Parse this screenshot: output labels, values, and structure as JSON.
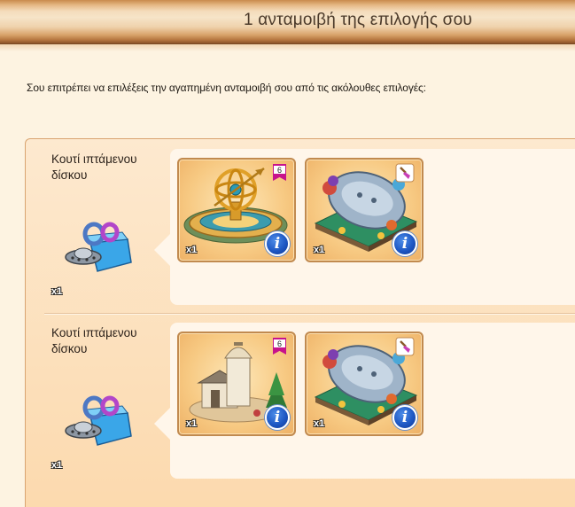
{
  "header": {
    "title": "1 ανταμοιβή της επιλογής σου"
  },
  "intro_text": "Σου επιτρέπει να επιλέξεις την αγαπημένη ανταμοιβή σου από τις ακόλουθες επιλογές:",
  "options": [
    {
      "source": {
        "name": "Κουτί ιπτάμενου δίσκου",
        "qty": "x1",
        "icon": "flying-saucer-box-icon"
      },
      "rewards": [
        {
          "icon": "armillary-sphere-decoration",
          "qty": "x1",
          "level_badge": "6"
        },
        {
          "icon": "ufo-crash-decoration",
          "qty": "x1",
          "badge_icon": "paintbrush-icon"
        }
      ]
    },
    {
      "source": {
        "name": "Κουτί ιπτάμενου δίσκου",
        "qty": "x1",
        "icon": "flying-saucer-box-icon"
      },
      "rewards": [
        {
          "icon": "observatory-building",
          "qty": "x1",
          "level_badge": "6"
        },
        {
          "icon": "ufo-crash-decoration",
          "qty": "x1",
          "badge_icon": "paintbrush-icon"
        }
      ]
    }
  ],
  "colors": {
    "info_button": "#1e58c4",
    "level_badge": "#c7138c",
    "panel_border": "#d9a470"
  }
}
